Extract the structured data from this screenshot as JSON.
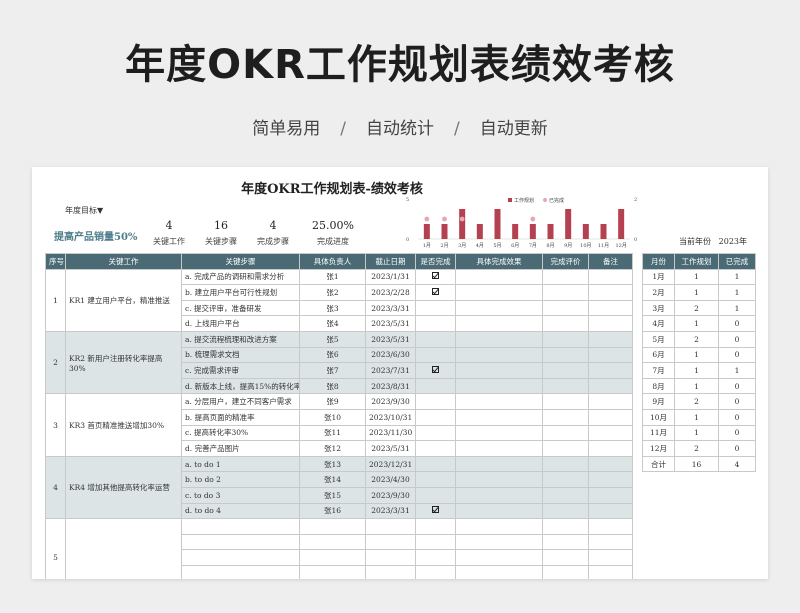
{
  "hero": {
    "title": "年度OKR工作规划表绩效考核",
    "features": [
      "简单易用",
      "自动统计",
      "自动更新"
    ],
    "separator": "/"
  },
  "sheet": {
    "title": "年度OKR工作规划表-绩效考核",
    "year_target_label": "年度目标▼",
    "goal": "提高产品销量50%",
    "stats": [
      {
        "value": "4",
        "label": "关键工作"
      },
      {
        "value": "16",
        "label": "关键步骤"
      },
      {
        "value": "4",
        "label": "完成步骤"
      },
      {
        "value": "25.00%",
        "label": "完成进度"
      }
    ],
    "current_month_label": "当前年份",
    "current_year": "2023年"
  },
  "chart_data": {
    "type": "bar",
    "categories": [
      "1月",
      "2月",
      "3月",
      "4月",
      "5月",
      "6月",
      "7月",
      "8月",
      "9月",
      "10月",
      "11月",
      "12月"
    ],
    "series": [
      {
        "name": "工作规划",
        "values": [
          1,
          1,
          2,
          1,
          2,
          1,
          1,
          1,
          2,
          1,
          1,
          2
        ],
        "color": "#b5404f"
      },
      {
        "name": "已完成",
        "values": [
          1,
          1,
          1,
          0,
          0,
          0,
          1,
          0,
          0,
          0,
          0,
          0
        ],
        "color": "#e8a7ae"
      }
    ],
    "ylim": [
      0,
      2
    ],
    "y2lim": [
      0,
      2
    ],
    "left_ticks": [
      "0",
      "5"
    ],
    "right_ticks": [
      "0",
      "2"
    ],
    "legend_position": "top-center"
  },
  "main_table": {
    "headers": [
      "序号",
      "关键工作",
      "关键步骤",
      "具体负责人",
      "截止日期",
      "是否完成",
      "具体完成效果",
      "完成评价",
      "备注"
    ],
    "groups": [
      {
        "no": "1",
        "work": "KR1  建立用户平台，精准推送",
        "shade": false,
        "rows": [
          {
            "step": "a. 完成产品的调研和需求分析",
            "owner": "张1",
            "date": "2023/1/31",
            "done": true
          },
          {
            "step": "b. 建立用户平台可行性规划",
            "owner": "张2",
            "date": "2023/2/28",
            "done": true
          },
          {
            "step": "c. 提交评审，准备研发",
            "owner": "张3",
            "date": "2023/3/31",
            "done": false
          },
          {
            "step": "d. 上线用户平台",
            "owner": "张4",
            "date": "2023/5/31",
            "done": false
          }
        ]
      },
      {
        "no": "2",
        "work": "KR2 新用户注册转化率提高30%",
        "shade": true,
        "rows": [
          {
            "step": "a. 提交流程梳理和改进方案",
            "owner": "张5",
            "date": "2023/5/31",
            "done": false
          },
          {
            "step": "b. 梳理需求文档",
            "owner": "张6",
            "date": "2023/6/30",
            "done": false
          },
          {
            "step": "c. 完成需求评审",
            "owner": "张7",
            "date": "2023/7/31",
            "done": true
          },
          {
            "step": "d. 新版本上线，提高15%的转化率",
            "owner": "张8",
            "date": "2023/8/31",
            "done": false
          }
        ]
      },
      {
        "no": "3",
        "work": "KR3    首页精准推送增加30%",
        "shade": false,
        "rows": [
          {
            "step": "a. 分层用户，建立不同客户需求",
            "owner": "张9",
            "date": "2023/9/30",
            "done": false
          },
          {
            "step": "b. 提高页面的精准率",
            "owner": "张10",
            "date": "2023/10/31",
            "done": false
          },
          {
            "step": "c. 提高转化率30%",
            "owner": "张11",
            "date": "2023/11/30",
            "done": false
          },
          {
            "step": "d. 完善产品图片",
            "owner": "张12",
            "date": "2023/5/31",
            "done": false
          }
        ]
      },
      {
        "no": "4",
        "work": "KR4  增加其他提高转化率运营",
        "shade": true,
        "rows": [
          {
            "step": "a.  to   do   1",
            "owner": "张13",
            "date": "2023/12/31",
            "done": false
          },
          {
            "step": "b.  to   do   2",
            "owner": "张14",
            "date": "2023/4/30",
            "done": false
          },
          {
            "step": "c.  to   do   3",
            "owner": "张15",
            "date": "2023/9/30",
            "done": false
          },
          {
            "step": "d.  to   do   4",
            "owner": "张16",
            "date": "2023/3/31",
            "done": true
          }
        ]
      },
      {
        "no": "5",
        "work": "",
        "shade": false,
        "rows": [
          {
            "step": "",
            "owner": "",
            "date": "",
            "done": false
          },
          {
            "step": "",
            "owner": "",
            "date": "",
            "done": false
          },
          {
            "step": "",
            "owner": "",
            "date": "",
            "done": false
          },
          {
            "step": "",
            "owner": "",
            "date": "",
            "done": false
          }
        ]
      }
    ]
  },
  "side_table": {
    "headers": [
      "月份",
      "工作规划",
      "已完成"
    ],
    "rows": [
      [
        "1月",
        "1",
        "1"
      ],
      [
        "2月",
        "1",
        "1"
      ],
      [
        "3月",
        "2",
        "1"
      ],
      [
        "4月",
        "1",
        "0"
      ],
      [
        "5月",
        "2",
        "0"
      ],
      [
        "6月",
        "1",
        "0"
      ],
      [
        "7月",
        "1",
        "1"
      ],
      [
        "8月",
        "1",
        "0"
      ],
      [
        "9月",
        "2",
        "0"
      ],
      [
        "10月",
        "1",
        "0"
      ],
      [
        "11月",
        "1",
        "0"
      ],
      [
        "12月",
        "2",
        "0"
      ],
      [
        "合计",
        "16",
        "4"
      ]
    ]
  }
}
